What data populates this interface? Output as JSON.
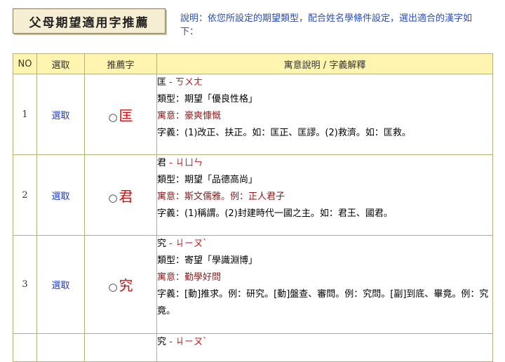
{
  "header": {
    "title": "父母期望適用字推薦",
    "description": "說明：依您所設定的期望類型，配合姓名學條件設定，選出適合的漢字如下："
  },
  "table": {
    "columns": [
      "NO",
      "選取",
      "推薦字",
      "寓意說明 / 字義解釋"
    ],
    "rows": [
      {
        "no": "1",
        "select": "選取",
        "radio": "○",
        "char": "匡",
        "head": "匡",
        "zhuyin": " - ㄎㄨㄤ",
        "type": "類型：期望「優良性格」",
        "meaning": "寓意：豪爽慷慨",
        "definition": "字義：(1)改正、扶正。如：匡正、匡謬。(2)救濟。如：匡救。"
      },
      {
        "no": "2",
        "select": "選取",
        "radio": "○",
        "char": "君",
        "head": "君",
        "zhuyin": " - ㄐㄩㄣ",
        "type": "類型：期望「品德高尚」",
        "meaning": "寓意：斯文儒雅。例：正人君子",
        "definition": "字義：(1)稱謂。(2)封建時代一國之主。如：君王、國君。"
      },
      {
        "no": "3",
        "select": "選取",
        "radio": "○",
        "char": "究",
        "head": "究",
        "zhuyin": " - ㄐㄧㄡˋ",
        "type": "類型：寄望「學識淵博」",
        "meaning": "寓意：勤學好問",
        "definition": "字義：[動]推求。例：研究。[動]盤查、審問。例：究問。[副]到底、畢竟。例：究竟。"
      },
      {
        "no": "",
        "select": "",
        "radio": "",
        "char": "",
        "head": "究",
        "zhuyin": " - ㄐㄧㄡˋ",
        "type": "",
        "meaning": "",
        "definition": ""
      }
    ]
  }
}
